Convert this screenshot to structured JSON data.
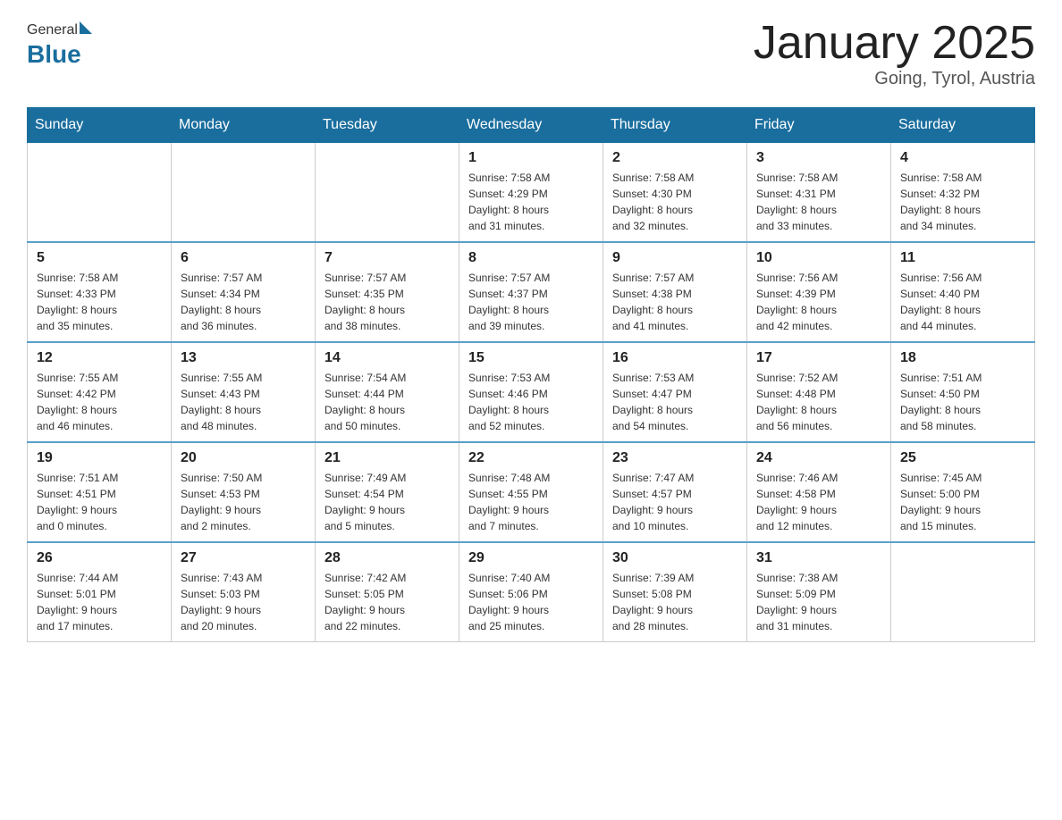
{
  "header": {
    "logo_general": "General",
    "logo_blue": "Blue",
    "title": "January 2025",
    "subtitle": "Going, Tyrol, Austria"
  },
  "days_of_week": [
    "Sunday",
    "Monday",
    "Tuesday",
    "Wednesday",
    "Thursday",
    "Friday",
    "Saturday"
  ],
  "weeks": [
    [
      {
        "day": "",
        "info": ""
      },
      {
        "day": "",
        "info": ""
      },
      {
        "day": "",
        "info": ""
      },
      {
        "day": "1",
        "info": "Sunrise: 7:58 AM\nSunset: 4:29 PM\nDaylight: 8 hours\nand 31 minutes."
      },
      {
        "day": "2",
        "info": "Sunrise: 7:58 AM\nSunset: 4:30 PM\nDaylight: 8 hours\nand 32 minutes."
      },
      {
        "day": "3",
        "info": "Sunrise: 7:58 AM\nSunset: 4:31 PM\nDaylight: 8 hours\nand 33 minutes."
      },
      {
        "day": "4",
        "info": "Sunrise: 7:58 AM\nSunset: 4:32 PM\nDaylight: 8 hours\nand 34 minutes."
      }
    ],
    [
      {
        "day": "5",
        "info": "Sunrise: 7:58 AM\nSunset: 4:33 PM\nDaylight: 8 hours\nand 35 minutes."
      },
      {
        "day": "6",
        "info": "Sunrise: 7:57 AM\nSunset: 4:34 PM\nDaylight: 8 hours\nand 36 minutes."
      },
      {
        "day": "7",
        "info": "Sunrise: 7:57 AM\nSunset: 4:35 PM\nDaylight: 8 hours\nand 38 minutes."
      },
      {
        "day": "8",
        "info": "Sunrise: 7:57 AM\nSunset: 4:37 PM\nDaylight: 8 hours\nand 39 minutes."
      },
      {
        "day": "9",
        "info": "Sunrise: 7:57 AM\nSunset: 4:38 PM\nDaylight: 8 hours\nand 41 minutes."
      },
      {
        "day": "10",
        "info": "Sunrise: 7:56 AM\nSunset: 4:39 PM\nDaylight: 8 hours\nand 42 minutes."
      },
      {
        "day": "11",
        "info": "Sunrise: 7:56 AM\nSunset: 4:40 PM\nDaylight: 8 hours\nand 44 minutes."
      }
    ],
    [
      {
        "day": "12",
        "info": "Sunrise: 7:55 AM\nSunset: 4:42 PM\nDaylight: 8 hours\nand 46 minutes."
      },
      {
        "day": "13",
        "info": "Sunrise: 7:55 AM\nSunset: 4:43 PM\nDaylight: 8 hours\nand 48 minutes."
      },
      {
        "day": "14",
        "info": "Sunrise: 7:54 AM\nSunset: 4:44 PM\nDaylight: 8 hours\nand 50 minutes."
      },
      {
        "day": "15",
        "info": "Sunrise: 7:53 AM\nSunset: 4:46 PM\nDaylight: 8 hours\nand 52 minutes."
      },
      {
        "day": "16",
        "info": "Sunrise: 7:53 AM\nSunset: 4:47 PM\nDaylight: 8 hours\nand 54 minutes."
      },
      {
        "day": "17",
        "info": "Sunrise: 7:52 AM\nSunset: 4:48 PM\nDaylight: 8 hours\nand 56 minutes."
      },
      {
        "day": "18",
        "info": "Sunrise: 7:51 AM\nSunset: 4:50 PM\nDaylight: 8 hours\nand 58 minutes."
      }
    ],
    [
      {
        "day": "19",
        "info": "Sunrise: 7:51 AM\nSunset: 4:51 PM\nDaylight: 9 hours\nand 0 minutes."
      },
      {
        "day": "20",
        "info": "Sunrise: 7:50 AM\nSunset: 4:53 PM\nDaylight: 9 hours\nand 2 minutes."
      },
      {
        "day": "21",
        "info": "Sunrise: 7:49 AM\nSunset: 4:54 PM\nDaylight: 9 hours\nand 5 minutes."
      },
      {
        "day": "22",
        "info": "Sunrise: 7:48 AM\nSunset: 4:55 PM\nDaylight: 9 hours\nand 7 minutes."
      },
      {
        "day": "23",
        "info": "Sunrise: 7:47 AM\nSunset: 4:57 PM\nDaylight: 9 hours\nand 10 minutes."
      },
      {
        "day": "24",
        "info": "Sunrise: 7:46 AM\nSunset: 4:58 PM\nDaylight: 9 hours\nand 12 minutes."
      },
      {
        "day": "25",
        "info": "Sunrise: 7:45 AM\nSunset: 5:00 PM\nDaylight: 9 hours\nand 15 minutes."
      }
    ],
    [
      {
        "day": "26",
        "info": "Sunrise: 7:44 AM\nSunset: 5:01 PM\nDaylight: 9 hours\nand 17 minutes."
      },
      {
        "day": "27",
        "info": "Sunrise: 7:43 AM\nSunset: 5:03 PM\nDaylight: 9 hours\nand 20 minutes."
      },
      {
        "day": "28",
        "info": "Sunrise: 7:42 AM\nSunset: 5:05 PM\nDaylight: 9 hours\nand 22 minutes."
      },
      {
        "day": "29",
        "info": "Sunrise: 7:40 AM\nSunset: 5:06 PM\nDaylight: 9 hours\nand 25 minutes."
      },
      {
        "day": "30",
        "info": "Sunrise: 7:39 AM\nSunset: 5:08 PM\nDaylight: 9 hours\nand 28 minutes."
      },
      {
        "day": "31",
        "info": "Sunrise: 7:38 AM\nSunset: 5:09 PM\nDaylight: 9 hours\nand 31 minutes."
      },
      {
        "day": "",
        "info": ""
      }
    ]
  ]
}
